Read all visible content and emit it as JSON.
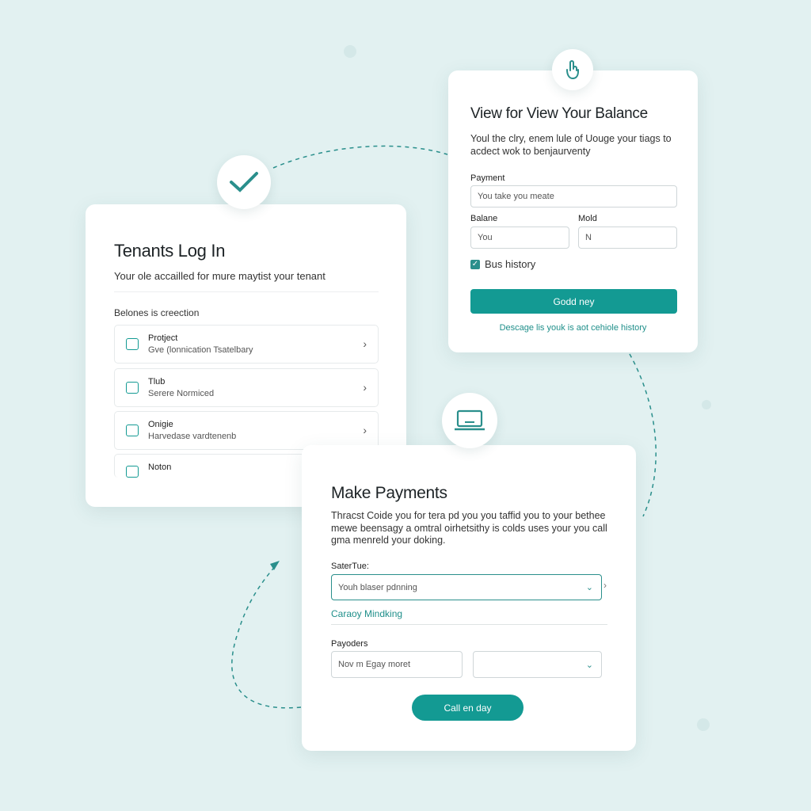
{
  "colors": {
    "accent": "#139a93",
    "background": "#e2f1f1"
  },
  "login": {
    "title": "Tenants Log In",
    "subtitle": "Your ole accailled for mure maytist your tenant",
    "section": "Belones is creection",
    "items": [
      {
        "title": "Protject",
        "sub": "Gve (lonnication Tsatelbary"
      },
      {
        "title": "Tlub",
        "sub": "Serere Normiced"
      },
      {
        "title": "Onigie",
        "sub": "Harvedase vardtenenb"
      },
      {
        "title": "Noton",
        "sub": ""
      }
    ]
  },
  "balance": {
    "title": "View for View Your Balance",
    "desc": "Youl the clry, enem lule of Uouge your tiags to acdect wok to benjaurventy",
    "payment_label": "Payment",
    "payment_value": "You take you meate",
    "balance_label": "Balane",
    "balance_value": "You",
    "mold_label": "Mold",
    "mold_value": "N",
    "checkbox_label": "Bus history",
    "checkbox_checked": true,
    "button": "Godd ney",
    "link": "Descage lis youk is aot cehiole history"
  },
  "payments": {
    "title": "Make Payments",
    "desc": "Thracst Coide you for tera pd you you taffid you to your bethee mewe beensagy a omtral oirhetsithy is colds uses your you call gma menreld your doking.",
    "select_label": "SaterTue:",
    "select_value": "Youh blaser pdnning",
    "link": "Caraoy Mindking",
    "payoders_label": "Payoders",
    "payoders_value": "Nov m Egay moret",
    "second_select_value": "",
    "button": "Call en day"
  }
}
